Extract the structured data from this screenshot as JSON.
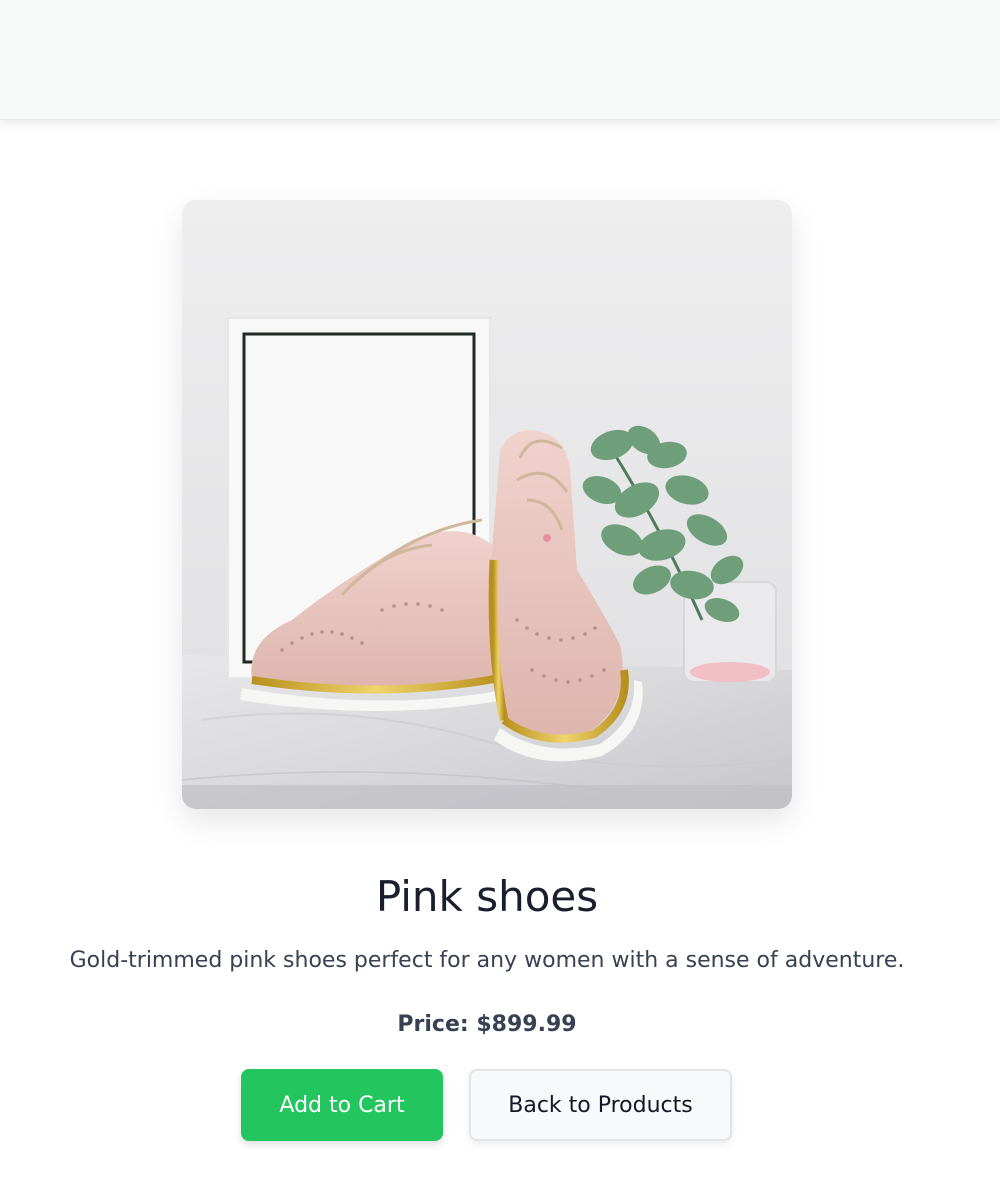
{
  "product": {
    "title": "Pink shoes",
    "description": "Gold-trimmed pink shoes perfect for any women with a sense of adventure.",
    "price_label": "Price: $899.99",
    "image_subject": "pink-shoes-photo"
  },
  "actions": {
    "add_to_cart_label": "Add to Cart",
    "back_label": "Back to Products"
  },
  "colors": {
    "primary_button": "#22c55e",
    "secondary_button": "#f8f9fa",
    "title_text": "#1a1f2e",
    "body_text": "#374151"
  }
}
